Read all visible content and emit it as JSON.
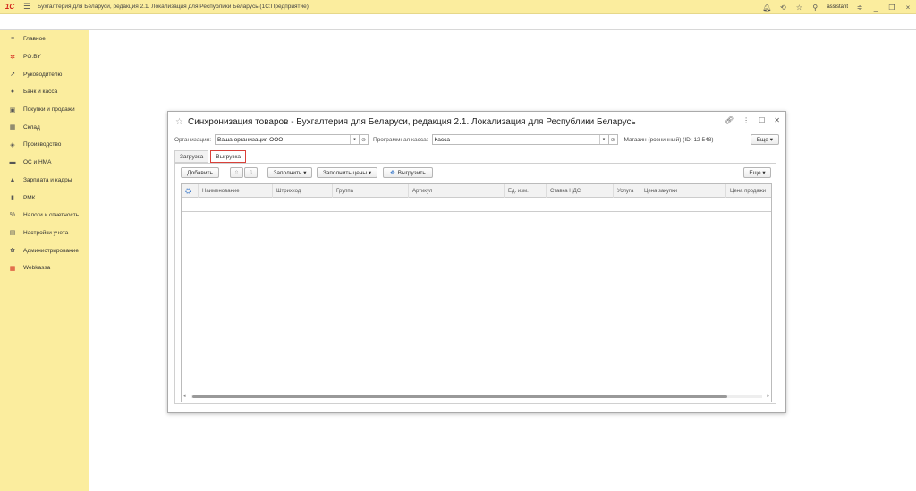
{
  "titlebar": {
    "logo": "1С",
    "title": "Бухгалтерия для Беларуси, редакция 2.1. Локализация для Республики Беларусь   (1С:Предприятие)",
    "user": "assistant"
  },
  "sidebar": {
    "items": [
      {
        "label": "Главное",
        "icon": "menu-lines-icon",
        "glyph": "≡"
      },
      {
        "label": "PO.BY",
        "icon": "sun-icon",
        "glyph": "✲"
      },
      {
        "label": "Руководителю",
        "icon": "chart-line-icon",
        "glyph": "↗"
      },
      {
        "label": "Банк и касса",
        "icon": "coins-icon",
        "glyph": "●"
      },
      {
        "label": "Покупки и продажи",
        "icon": "cart-icon",
        "glyph": "▣"
      },
      {
        "label": "Склад",
        "icon": "warehouse-icon",
        "glyph": "▦"
      },
      {
        "label": "Производство",
        "icon": "factory-icon",
        "glyph": "◈"
      },
      {
        "label": "ОС и НМА",
        "icon": "truck-icon",
        "glyph": "▬"
      },
      {
        "label": "Зарплата и кадры",
        "icon": "person-icon",
        "glyph": "▲"
      },
      {
        "label": "РМК",
        "icon": "register-icon",
        "glyph": "▮"
      },
      {
        "label": "Налоги и отчетность",
        "icon": "percent-icon",
        "glyph": "%"
      },
      {
        "label": "Настройки учета",
        "icon": "book-icon",
        "glyph": "▤"
      },
      {
        "label": "Администрирование",
        "icon": "gear-icon",
        "glyph": "✿"
      },
      {
        "label": "Webkassa",
        "icon": "calculator-icon",
        "glyph": "▦"
      }
    ]
  },
  "dialog": {
    "title": "Синхронизация товаров - Бухгалтерия для Беларуси, редакция 2.1. Локализация для Республики Беларусь",
    "org_label": "Организация:",
    "org_value": "Ваша организация ООО",
    "kassa_label": "Программная касса:",
    "kassa_value": "Касса",
    "store_info": "Магазин (розничный) (ID: 12 548)",
    "more_label": "Еще",
    "tabs": [
      "Загрузка",
      "Выгрузка"
    ],
    "toolbar": {
      "add": "Добавить",
      "fill": "Заполнить",
      "fill_prices": "Заполнить цены",
      "export": "Выгрузить",
      "more": "Еще"
    },
    "columns": [
      "Наименование",
      "Штрихкод",
      "Группа",
      "Артикул",
      "Ед. изм.",
      "Ставка НДС",
      "Услуга",
      "Цена закупки",
      "Цена продажи"
    ]
  }
}
